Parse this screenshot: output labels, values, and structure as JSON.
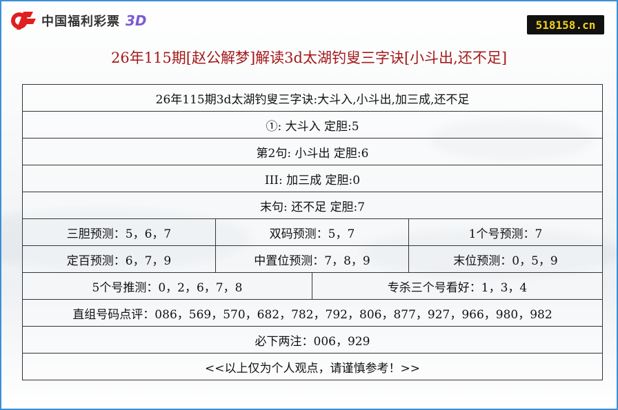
{
  "logo": {
    "brand": "中国福利彩票",
    "suffix": "3D"
  },
  "site_badge": "518158.cn",
  "title": "26年115期[赵公解梦]解读3d太湖钓叟三字诀[小斗出,还不足]",
  "rows": {
    "poem": "26年115期3d太湖钓叟三字诀:大斗入,小斗出,加三成,还不足",
    "line1": "①: 大斗入 定胆:5",
    "line2": "第2句: 小斗出 定胆:6",
    "line3": "III: 加三成 定胆:0",
    "line4": "末句: 还不足 定胆:7",
    "sandan": "三胆预测：5，6，7",
    "shuangma": "双码预测：5，7",
    "yige": "1个号预测：7",
    "dingbai": "定百预测：6，7，9",
    "zhongzhi": "中置位预测：7，8，9",
    "mowei": "末位预测：0，5，9",
    "wuge": "5个号推测：0，2，6，7，8",
    "zhuansha": "专杀三个号看好：1，3，4",
    "zhizu": "直组号码点评：086，569，570，682，782，792，806，877，927，966，980，982",
    "bixia": "必下两注：006，929",
    "disclaimer": "<<以上仅为个人观点，请谨慎参考！>>"
  }
}
